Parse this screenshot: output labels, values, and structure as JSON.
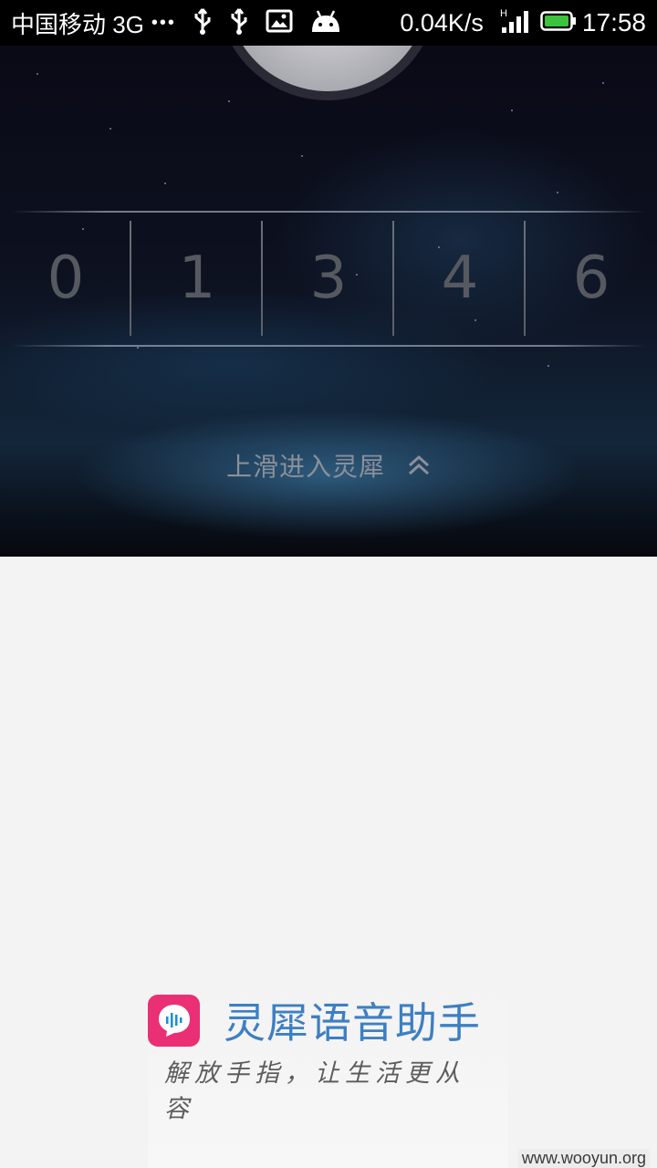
{
  "status_bar": {
    "carrier": "中国移动 3G",
    "dots": "•••",
    "net_speed": "0.04K/s",
    "network_type": "H",
    "time": "17:58",
    "icons": [
      "usb-icon",
      "usb-icon",
      "image-icon",
      "android-icon",
      "signal-icon",
      "battery-icon"
    ],
    "battery_color": "#3cc23c"
  },
  "lockscreen": {
    "digits": [
      "0",
      "1",
      "3",
      "4",
      "6"
    ],
    "swipe_text": "上滑进入灵犀",
    "swipe_icon": "chevron-up-icon"
  },
  "brand": {
    "name": "灵犀语音助手",
    "slogan": "解放手指，让生活更从容",
    "logo_color": "#ea2f74",
    "name_color": "#3d7fc3"
  },
  "watermark": "www.wooyun.org"
}
